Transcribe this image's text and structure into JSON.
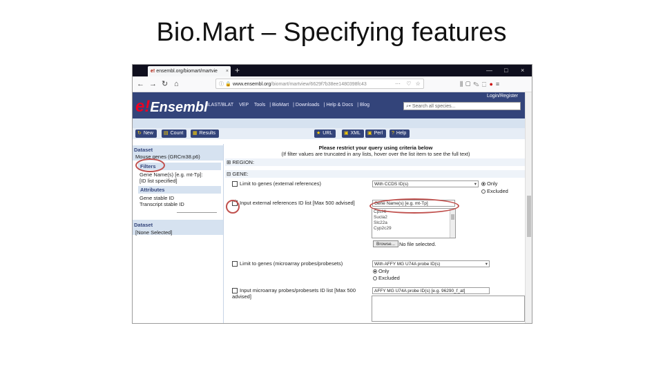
{
  "slide": {
    "title": "Bio.Mart – Specifying features"
  },
  "browser": {
    "tab_title": "ensembl.org/biomart/martvie",
    "tab_close": "×",
    "new_tab": "+",
    "window_controls": [
      "—",
      "□",
      "×"
    ],
    "url_host": "www.ensembl.org",
    "url_path": "/biomart/martview/6629f7b38ee1480398fc43",
    "url_more": "···",
    "toolbar_icons": [
      "library-icon",
      "sidebar-icon",
      "note-icon",
      "extension-icon",
      "adblock-icon",
      "menu-icon"
    ]
  },
  "ensembl": {
    "logo": "Ensembl",
    "login": "Login/Register",
    "nav": [
      "BLAST/BLAT",
      "VEP",
      "Tools",
      "BioMart",
      "Downloads",
      "Help & Docs",
      "Blog"
    ],
    "search_placeholder": "Search all species..."
  },
  "toolbar": {
    "left": [
      "New",
      "Count",
      "Results"
    ],
    "right": [
      "URL",
      "XML",
      "Perl",
      "Help"
    ]
  },
  "leftpanel": {
    "dataset_label": "Dataset",
    "dataset_value": "Mouse genes (GRCm38.p6)",
    "filters_label": "Filters",
    "filter_summary_1": "Gene Name(s) [e.g. mt-Tp]:",
    "filter_summary_2": "[ID list specified]",
    "attributes_label": "Attributes",
    "attr_1": "Gene stable ID",
    "attr_2": "Transcript stable ID",
    "dataset2_label": "Dataset",
    "dataset2_value": "[None Selected]"
  },
  "main": {
    "notice_title": "Please restrict your query using criteria below",
    "notice_sub": "(If filter values are truncated in any lists, hover over the list item to see the full text)",
    "region_label": "REGION:",
    "gene_label": "GENE:",
    "limit_external": "Limit to genes (external references)",
    "limit_external_select": "With CCDS ID(s)",
    "only_label": "Only",
    "excluded_label": "Excluded",
    "input_external": "Input external references ID list [Max 500 advised]",
    "input_external_select": "Gene Name(s) [e.g. mt-Tp]",
    "id_list": [
      "Cpsf4l",
      "Sucla2",
      "Slc22a",
      "Cyp2c29"
    ],
    "browse_button": "Browse...",
    "file_status": "No file selected.",
    "limit_microarray": "Limit to genes (microarray probes/probesets)",
    "limit_microarray_select": "With AFFY MG U74A probe ID(s)",
    "input_microarray": "Input microarray probes/probesets ID list [Max 500 advised]",
    "input_microarray_select": "AFFY MG U74A probe ID(s) [e.g. 96290_f_at]"
  },
  "colors": {
    "ensembl_blue": "#33447a",
    "highlight": "#c0504d",
    "band": "#d6e2f0"
  }
}
